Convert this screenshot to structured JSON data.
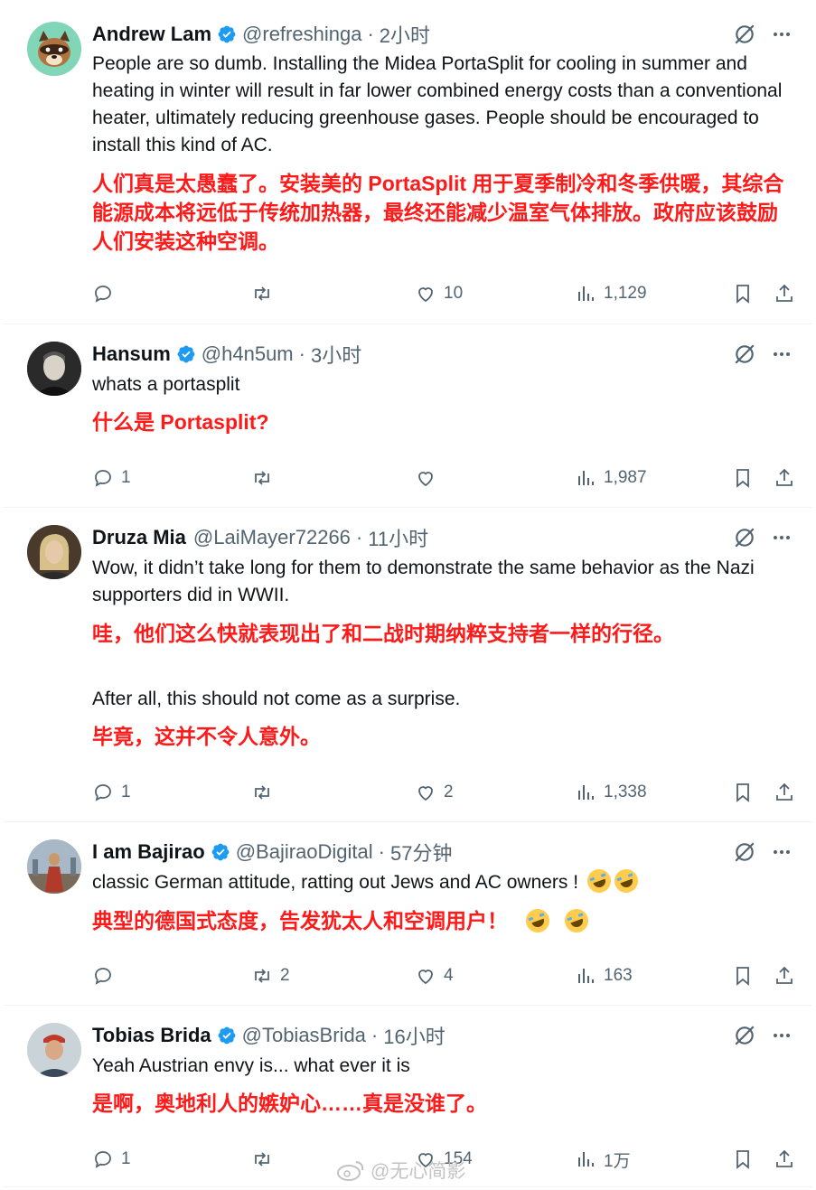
{
  "tweets": [
    {
      "name": "Andrew Lam",
      "handle": "@refreshinga",
      "time": "2小时",
      "text": "People are so dumb. Installing the Midea PortaSplit for cooling in summer and heating in winter will result in far lower combined energy costs than a conventional heater, ultimately reducing greenhouse gases. People should be encouraged to install this kind of AC.",
      "translation": "人们真是太愚蠢了。安装美的 PortaSplit 用于夏季制冷和冬季供暖，其综合能源成本将远低于传统加热器，最终还能减少温室气体排放。政府应该鼓励人们安装这种空调。",
      "replies": "",
      "reposts": "",
      "likes": "10",
      "views": "1,129"
    },
    {
      "name": "Hansum",
      "handle": "@h4n5um",
      "time": "3小时",
      "text": "whats a portasplit",
      "translation": "什么是 Portasplit?",
      "replies": "1",
      "reposts": "",
      "likes": "",
      "views": "1,987"
    },
    {
      "name": "Druza Mia",
      "handle": "@LaiMayer72266",
      "time": "11小时",
      "text": "Wow, it didn’t take long for them to demonstrate the same behavior as the Nazi supporters did in WWII.",
      "translation": "哇，他们这么快就表现出了和二战时期纳粹支持者一样的行径。",
      "text2": "After all, this should not come as a surprise.",
      "translation2": "毕竟，这并不令人意外。",
      "replies": "1",
      "reposts": "",
      "likes": "2",
      "views": "1,338"
    },
    {
      "name": "I am Bajirao",
      "handle": "@BajiraoDigital",
      "time": "57分钟",
      "text": "classic German attitude, ratting out Jews and AC owners !",
      "translation": "典型的德国式态度，告发犹太人和空调用户！",
      "replies": "",
      "reposts": "2",
      "likes": "4",
      "views": "163"
    },
    {
      "name": "Tobias Brida",
      "handle": "@TobiasBrida",
      "time": "16小时",
      "text": "Yeah Austrian envy is... what ever it is",
      "translation": "是啊，奥地利人的嫉妒心……真是没谁了。",
      "replies": "1",
      "reposts": "",
      "likes": "154",
      "views": "1万"
    }
  ],
  "separator": "·",
  "watermark": "@无心简影",
  "colors": {
    "verified": "#1d9bf0",
    "translation": "#ff1a1a",
    "meta": "#536471"
  },
  "icons": [
    "verified-badge-icon",
    "grok-icon",
    "more-icon",
    "reply-icon",
    "repost-icon",
    "like-icon",
    "views-icon",
    "bookmark-icon",
    "share-icon",
    "rofl-emoji-icon",
    "weibo-icon"
  ]
}
